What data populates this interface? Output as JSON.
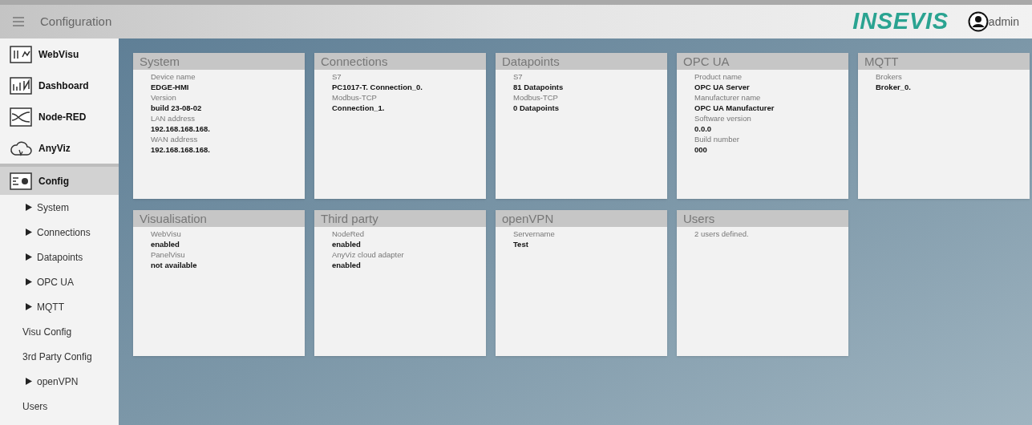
{
  "header": {
    "title": "Configuration",
    "logo": "INSEVIS",
    "user": "admin"
  },
  "sidebar": {
    "items": [
      {
        "kind": "app",
        "label": "WebVisu",
        "selected": false
      },
      {
        "kind": "app",
        "label": "Dashboard",
        "selected": false
      },
      {
        "kind": "app",
        "label": "Node-RED",
        "selected": false
      },
      {
        "kind": "app",
        "label": "AnyViz",
        "selected": false
      },
      {
        "kind": "app",
        "label": "Config",
        "selected": true
      },
      {
        "kind": "expandable",
        "label": "System",
        "selected": false
      },
      {
        "kind": "expandable",
        "label": "Connections",
        "selected": false
      },
      {
        "kind": "expandable",
        "label": "Datapoints",
        "selected": false
      },
      {
        "kind": "expandable",
        "label": "OPC UA",
        "selected": false
      },
      {
        "kind": "expandable",
        "label": "MQTT",
        "selected": false
      },
      {
        "kind": "link",
        "label": "Visu Config",
        "selected": false
      },
      {
        "kind": "link",
        "label": "3rd Party Config",
        "selected": false
      },
      {
        "kind": "expandable",
        "label": "openVPN",
        "selected": false
      },
      {
        "kind": "link",
        "label": "Users",
        "selected": false
      }
    ]
  },
  "cards": [
    {
      "title": "System",
      "lines": [
        {
          "kind": "label",
          "text": "Device name"
        },
        {
          "kind": "value",
          "text": "EDGE-HMI"
        },
        {
          "kind": "label",
          "text": "Version"
        },
        {
          "kind": "value",
          "text": "build 23-08-02"
        },
        {
          "kind": "label",
          "text": "LAN address"
        },
        {
          "kind": "value",
          "text": "192.168.168.168."
        },
        {
          "kind": "label",
          "text": "WAN address"
        },
        {
          "kind": "value",
          "text": "192.168.168.168."
        }
      ]
    },
    {
      "title": "Connections",
      "lines": [
        {
          "kind": "label",
          "text": "S7"
        },
        {
          "kind": "value",
          "text": "PC1017-T. Connection_0."
        },
        {
          "kind": "label",
          "text": "Modbus-TCP"
        },
        {
          "kind": "value",
          "text": "Connection_1."
        }
      ]
    },
    {
      "title": "Datapoints",
      "lines": [
        {
          "kind": "label",
          "text": "S7"
        },
        {
          "kind": "value",
          "text": "81 Datapoints"
        },
        {
          "kind": "label",
          "text": "Modbus-TCP"
        },
        {
          "kind": "value",
          "text": "0 Datapoints"
        }
      ]
    },
    {
      "title": "OPC UA",
      "lines": [
        {
          "kind": "label",
          "text": "Product name"
        },
        {
          "kind": "value",
          "text": "OPC UA Server"
        },
        {
          "kind": "label",
          "text": "Manufacturer name"
        },
        {
          "kind": "value",
          "text": "OPC UA Manufacturer"
        },
        {
          "kind": "label",
          "text": "Software version"
        },
        {
          "kind": "value",
          "text": "0.0.0"
        },
        {
          "kind": "label",
          "text": "Build number"
        },
        {
          "kind": "value",
          "text": "000"
        }
      ]
    },
    {
      "title": "MQTT",
      "lines": [
        {
          "kind": "label",
          "text": "Brokers"
        },
        {
          "kind": "value",
          "text": "Broker_0."
        }
      ]
    },
    {
      "title": "Visualisation",
      "lines": [
        {
          "kind": "label",
          "text": "WebVisu"
        },
        {
          "kind": "value",
          "text": "enabled"
        },
        {
          "kind": "label",
          "text": "PanelVisu"
        },
        {
          "kind": "value",
          "text": "not available"
        }
      ]
    },
    {
      "title": "Third party",
      "lines": [
        {
          "kind": "label",
          "text": "NodeRed"
        },
        {
          "kind": "value",
          "text": "enabled"
        },
        {
          "kind": "label",
          "text": "AnyViz cloud adapter"
        },
        {
          "kind": "value",
          "text": "enabled"
        }
      ]
    },
    {
      "title": "openVPN",
      "lines": [
        {
          "kind": "label",
          "text": "Servername"
        },
        {
          "kind": "value",
          "text": "Test"
        }
      ]
    },
    {
      "title": "Users",
      "lines": [
        {
          "kind": "label",
          "text": "2 users defined."
        }
      ]
    }
  ]
}
